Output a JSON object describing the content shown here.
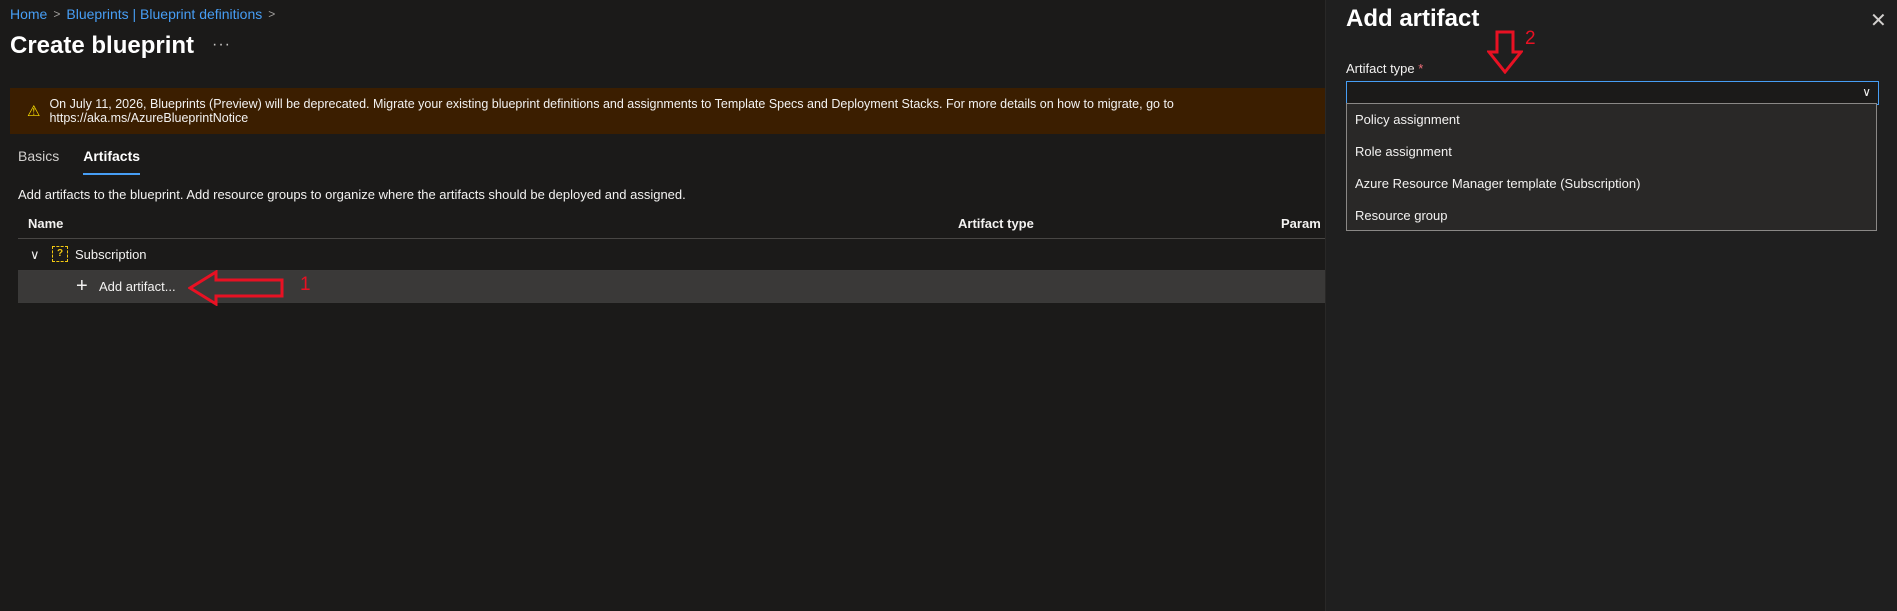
{
  "breadcrumb": {
    "home": "Home",
    "blueprints": "Blueprints | Blueprint definitions"
  },
  "page": {
    "title": "Create blueprint",
    "more": "···"
  },
  "banner": {
    "text": "On July 11, 2026, Blueprints (Preview) will be deprecated. Migrate your existing blueprint definitions and assignments to Template Specs and Deployment Stacks. For more details on how to migrate, go to https://aka.ms/AzureBlueprintNotice"
  },
  "tabs": [
    {
      "label": "Basics"
    },
    {
      "label": "Artifacts"
    }
  ],
  "description": "Add artifacts to the blueprint. Add resource groups to organize where the artifacts should be deployed and assigned.",
  "table": {
    "columns": [
      "Name",
      "Artifact type",
      "Param"
    ],
    "rows": [
      {
        "label": "Subscription"
      },
      {
        "label": "Add artifact..."
      }
    ]
  },
  "annotations": {
    "one": "1",
    "two": "2"
  },
  "panel": {
    "title": "Add artifact",
    "field_label": "Artifact type",
    "required_mark": "*",
    "options": [
      "Policy assignment",
      "Role assignment",
      "Azure Resource Manager template (Subscription)",
      "Resource group"
    ]
  },
  "colors": {
    "accent": "#479ef5",
    "annotation": "#e81123",
    "warning_bg": "#3b1e00"
  }
}
